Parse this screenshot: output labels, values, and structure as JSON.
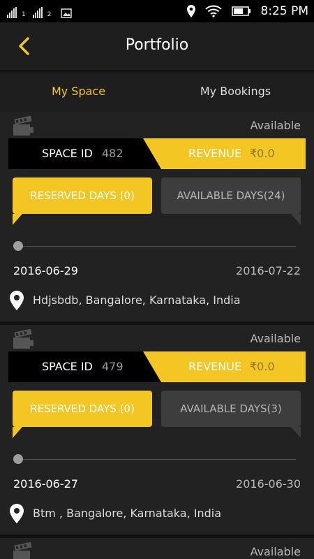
{
  "status_bar": {
    "sim1": "1",
    "sim2": "2",
    "time": "8:25 PM",
    "icons": [
      "signal-icon",
      "signal-icon",
      "image-icon",
      "location-icon",
      "wifi-icon",
      "battery-icon"
    ]
  },
  "header": {
    "title": "Portfolio",
    "back_icon": "chevron-left-icon"
  },
  "tabs": [
    {
      "label": "My Space",
      "active": true
    },
    {
      "label": "My Bookings",
      "active": false
    }
  ],
  "cards": [
    {
      "status": "Available",
      "space_id_label": "SPACE ID",
      "space_id": "482",
      "revenue_label": "REVENUE",
      "revenue": "₹0.0",
      "reserved_days": "RESERVED DAYS (0)",
      "available_days": "AVAILABLE DAYS(24)",
      "start_date": "2016-06-29",
      "end_date": "2016-07-22",
      "address": "Hdjsbdb, Bangalore, Karnataka, India",
      "progress": 0
    },
    {
      "status": "Available",
      "space_id_label": "SPACE ID",
      "space_id": "479",
      "revenue_label": "REVENUE",
      "revenue": "₹0.0",
      "reserved_days": "RESERVED DAYS (0)",
      "available_days": "AVAILABLE DAYS(3)",
      "start_date": "2016-06-27",
      "end_date": "2016-06-30",
      "address": "Btm , Bangalore, Karnataka, India",
      "progress": 0
    },
    {
      "status": "Available"
    }
  ],
  "colors": {
    "accent": "#f3c623",
    "background": "#1e1e1e",
    "card": "#222222",
    "id_bar": "#000000",
    "inactive_button": "#3d3d3d"
  }
}
